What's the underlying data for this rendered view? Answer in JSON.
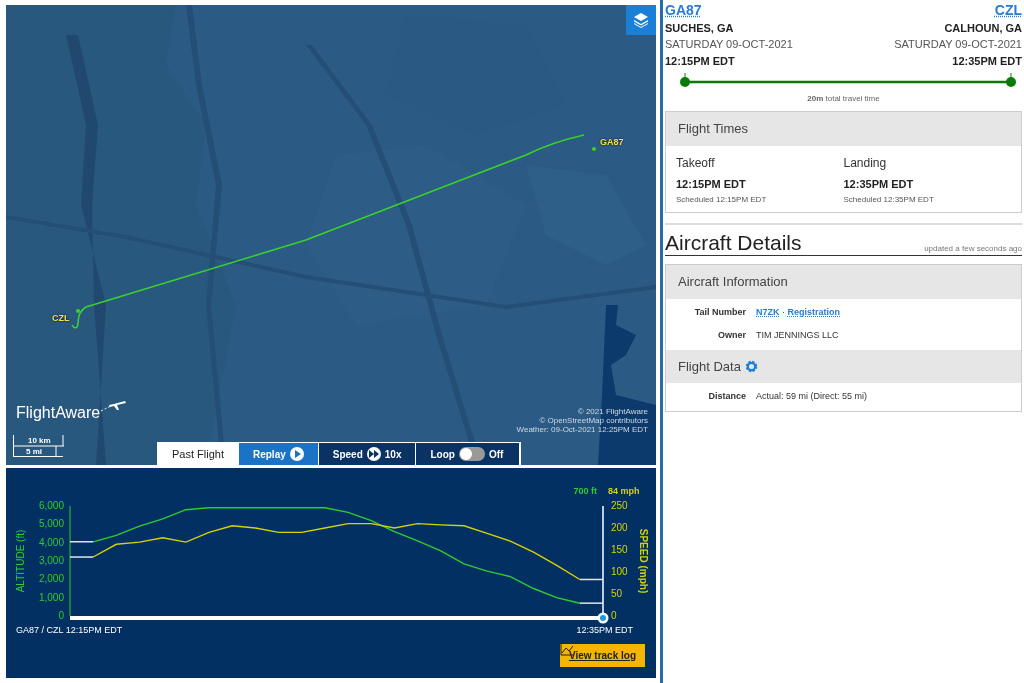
{
  "map": {
    "airports": [
      {
        "code": "GA87",
        "kind": "origin"
      },
      {
        "code": "CZL",
        "kind": "destination"
      }
    ],
    "logo": "FlightAware",
    "scale": [
      "10 km",
      "5 mi"
    ],
    "attribution": [
      "© 2021 FlightAware",
      "© OpenStreetMap contributors",
      "Weather: 09-Oct-2021 12:25PM EDT"
    ]
  },
  "controls": {
    "mode_tab": {
      "label": "Past Flight",
      "selected": true
    },
    "replay": {
      "label": "Replay"
    },
    "speed": {
      "label": "Speed",
      "value": "10x"
    },
    "loop": {
      "label": "Loop",
      "on": false,
      "value": "Off"
    }
  },
  "profile": {
    "altitude_readout": "700 ft",
    "speed_readout": "84 mph",
    "playback": {
      "level": 1
    },
    "altitude_chart": {
      "chart_data": {
        "type": "line",
        "ylabel": "ALTITUDE (ft)",
        "ylim": [
          0,
          6000
        ],
        "categories": [
          "GA87 / CZL 12:15PM EDT",
          null,
          null,
          null,
          null,
          null,
          null,
          null,
          null,
          null,
          null,
          null,
          null,
          null,
          null,
          null,
          null,
          null,
          null,
          null,
          null,
          null,
          null,
          "12:35PM EDT"
        ],
        "yticks": [
          {
            "value": 0,
            "label": "0"
          },
          {
            "value": 1000,
            "label": "1,000"
          },
          {
            "value": 2000,
            "label": "2,000"
          },
          {
            "value": 3000,
            "label": "3,000"
          },
          {
            "value": 4000,
            "label": "4,000"
          },
          {
            "value": 5000,
            "label": "5,000"
          },
          {
            "value": 6000,
            "label": "6,000"
          }
        ],
        "series": [
          {
            "color": "#2ecc2e",
            "values": [
              null,
              4050,
              4400,
              4900,
              5300,
              5800,
              5900,
              5900,
              5900,
              5900,
              5900,
              5900,
              5650,
              5200,
              4600,
              4100,
              3550,
              2850,
              2450,
              2150,
              1500,
              1000,
              700,
              null
            ]
          }
        ]
      }
    },
    "speed_chart": {
      "chart_data": {
        "type": "line",
        "ylabel": "SPEED (mph)",
        "ylim": [
          0,
          250
        ],
        "yticks": [
          0,
          50,
          100,
          150,
          200,
          250
        ],
        "categories": [
          null,
          null,
          null,
          null,
          null,
          null,
          null,
          null,
          null,
          null,
          null,
          null,
          null,
          null,
          null,
          null,
          null,
          null,
          null,
          null,
          null,
          null,
          null,
          null
        ],
        "series": [
          {
            "color": "#d4d400",
            "values": [
              null,
              134,
              163,
              168,
              178,
              168,
              190,
              205,
              200,
              190,
              190,
              200,
              210,
              210,
              200,
              210,
              207,
              205,
              188,
              170,
              145,
              115,
              83,
              null
            ]
          }
        ]
      }
    },
    "track_log_button": "View track log"
  },
  "route": {
    "origin": {
      "code": "GA87",
      "city": "SUCHES, GA",
      "date": "SATURDAY 09-OCT-2021",
      "time": "12:15PM EDT"
    },
    "destination": {
      "code": "CZL",
      "city": "CALHOUN, GA",
      "date": "SATURDAY 09-OCT-2021",
      "time": "12:35PM EDT"
    },
    "travel_time": "**20m** total travel time"
  },
  "flight_times": {
    "title": "Flight Times",
    "items": [
      {
        "label": "Takeoff",
        "time": "12:15PM EDT",
        "scheduled": "Scheduled 12:15PM EDT"
      },
      {
        "label": "Landing",
        "time": "12:35PM EDT",
        "scheduled": "Scheduled 12:35PM EDT"
      }
    ]
  },
  "aircraft_details": {
    "title": "Aircraft Details",
    "updated": "updated a few seconds ago",
    "sections": [
      {
        "title": "Aircraft Information",
        "rows": [
          {
            "kind": "links",
            "label": "Tail Number",
            "links": [
              "N7ZK",
              "Registration"
            ],
            "separator": "·"
          },
          {
            "kind": "text",
            "label": "Owner",
            "value": "TIM JENNINGS LLC"
          }
        ]
      },
      {
        "title": "Flight Data",
        "gear": true,
        "rows": [
          {
            "kind": "text",
            "label": "Distance",
            "value": "Actual: 59 mi (Direct: 55 mi)"
          }
        ]
      }
    ]
  }
}
